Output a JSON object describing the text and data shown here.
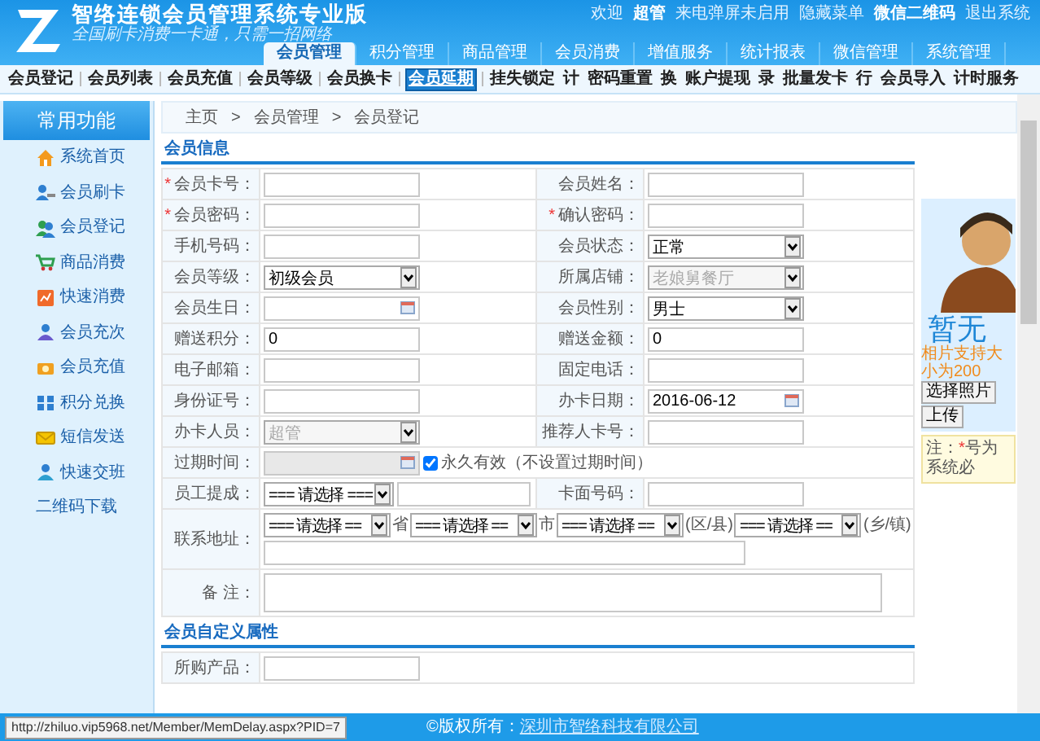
{
  "header": {
    "title": "智络连锁会员管理系统专业版",
    "slogan": "全国刷卡消费一卡通，只需一招网络",
    "user_links": [
      {
        "text": "欢迎",
        "bold": false
      },
      {
        "text": "超管",
        "bold": true
      },
      {
        "text": "来电弹屏未启用",
        "bold": false
      },
      {
        "text": "隐藏菜单",
        "bold": false
      },
      {
        "text": "微信二维码",
        "bold": true
      },
      {
        "text": "退出系统",
        "bold": false
      }
    ]
  },
  "main_tabs": [
    {
      "label": "会员管理",
      "selected": true
    },
    {
      "label": "积分管理",
      "selected": false
    },
    {
      "label": "商品管理",
      "selected": false
    },
    {
      "label": "会员消费",
      "selected": false
    },
    {
      "label": "增值服务",
      "selected": false
    },
    {
      "label": "统计报表",
      "selected": false
    },
    {
      "label": "微信管理",
      "selected": false
    },
    {
      "label": "系统管理",
      "selected": false
    }
  ],
  "sub_tabs": [
    {
      "label": "会员登记",
      "selected": false
    },
    {
      "label": "会员列表",
      "selected": false
    },
    {
      "label": "会员充值",
      "selected": false
    },
    {
      "label": "会员等级",
      "selected": false
    },
    {
      "label": "会员换卡",
      "selected": false
    },
    {
      "label": "会员延期",
      "selected": true
    },
    {
      "label": "挂失锁定",
      "selected": false
    },
    {
      "label": "计",
      "selected": false
    },
    {
      "label": "密码重置",
      "selected": false
    },
    {
      "label": "换",
      "selected": false
    },
    {
      "label": "账户提现",
      "selected": false
    },
    {
      "label": "录",
      "selected": false
    },
    {
      "label": "批量发卡",
      "selected": false
    },
    {
      "label": "行",
      "selected": false
    },
    {
      "label": "会员导入",
      "selected": false
    },
    {
      "label": "计时服务",
      "selected": false
    }
  ],
  "sidebar": {
    "title": "常用功能",
    "items": [
      {
        "label": "系统首页"
      },
      {
        "label": "会员刷卡"
      },
      {
        "label": "会员登记"
      },
      {
        "label": "商品消费"
      },
      {
        "label": "快速消费"
      },
      {
        "label": "会员充次"
      },
      {
        "label": "会员充值"
      },
      {
        "label": "积分兑换"
      },
      {
        "label": "短信发送"
      },
      {
        "label": "快速交班"
      },
      {
        "label": "二维码下载"
      }
    ]
  },
  "breadcrumb": [
    "主页",
    "会员管理",
    "会员登记"
  ],
  "breadcrumb_separator": ">",
  "member_info": {
    "title": "会员信息",
    "rows": [
      {
        "cells": [
          {
            "label": "会员卡号：",
            "mark": "*",
            "field": {
              "kind": "text"
            }
          },
          {
            "label": "会员姓名：",
            "field": {
              "kind": "text"
            }
          }
        ]
      },
      {
        "cells": [
          {
            "label": "会员密码：",
            "mark": "*",
            "field": {
              "kind": "text"
            }
          },
          {
            "label": "确认密码：",
            "mark": "*",
            "field": {
              "kind": "text"
            }
          }
        ]
      },
      {
        "cells": [
          {
            "label": "手机号码：",
            "field": {
              "kind": "text"
            }
          },
          {
            "label": "会员状态：",
            "field": {
              "kind": "select",
              "value": "正常",
              "disabled": false
            }
          }
        ]
      },
      {
        "cells": [
          {
            "label": "会员等级：",
            "field": {
              "kind": "select",
              "value": "初级会员",
              "disabled": false
            }
          },
          {
            "label": "所属店铺：",
            "field": {
              "kind": "select",
              "value": "老娘舅餐厅",
              "disabled": true
            }
          }
        ]
      },
      {
        "cells": [
          {
            "label": "会员生日：",
            "field": {
              "kind": "date",
              "disabled": false
            }
          },
          {
            "label": "会员性别：",
            "field": {
              "kind": "select",
              "value": "男士",
              "disabled": false
            }
          }
        ]
      },
      {
        "cells": [
          {
            "label": "赠送积分：",
            "field": {
              "kind": "text",
              "value": "0"
            }
          },
          {
            "label": "赠送金额：",
            "field": {
              "kind": "text",
              "value": "0"
            }
          }
        ]
      },
      {
        "cells": [
          {
            "label": "电子邮箱：",
            "field": {
              "kind": "text"
            }
          },
          {
            "label": "固定电话：",
            "field": {
              "kind": "text"
            }
          }
        ]
      },
      {
        "cells": [
          {
            "label": "身份证号：",
            "field": {
              "kind": "text"
            }
          },
          {
            "label": "办卡日期：",
            "field": {
              "kind": "date",
              "value": "2016-06-12",
              "disabled": false
            }
          }
        ]
      },
      {
        "cells": [
          {
            "label": "办卡人员：",
            "field": {
              "kind": "select",
              "value": "超管",
              "disabled": true
            }
          },
          {
            "label": "推荐人卡号：",
            "field": {
              "kind": "text"
            }
          }
        ]
      },
      {
        "cells": [
          {
            "label": "过期时间：",
            "field": {
              "kind": "check_date",
              "disabled": true,
              "checkbox": {
                "label": "永久有效（不设置过期时间）",
                "checked": true
              }
            }
          }
        ]
      },
      {
        "cells": [
          {
            "label": "员工提成：",
            "field": {
              "kind": "select_text",
              "value": "=== 请选择 ==="
            }
          },
          {
            "label": "卡面号码：",
            "field": {
              "kind": "text"
            }
          }
        ]
      },
      {
        "cells": [
          {
            "label": "联系地址：",
            "field": {
              "kind": "address",
              "selects": [
                {
                  "value": "=== 请选择 ==",
                  "suffix": "省"
                },
                {
                  "value": "=== 请选择 ==",
                  "suffix": "市"
                },
                {
                  "value": "=== 请选择 ==",
                  "suffix": "(区/县)"
                },
                {
                  "value": "=== 请选择 ==",
                  "suffix": "(乡/镇)"
                }
              ]
            }
          }
        ]
      },
      {
        "cells": [
          {
            "label": "备  注：",
            "field": {
              "kind": "textarea"
            }
          }
        ]
      }
    ]
  },
  "custom_attributes": {
    "title": "会员自定义属性",
    "rows": [
      {
        "cells": [
          {
            "label": "所购产品：",
            "field": {
              "kind": "text"
            }
          }
        ]
      }
    ]
  },
  "photo_panel": {
    "no_photo_text": "暂无",
    "hint": "相片支持大小为200",
    "buttons": [
      "选择照片",
      "上传"
    ],
    "note": {
      "prefix": "注：",
      "mark": "*",
      "text": "号为系统必"
    }
  },
  "status_url": "http://zhiluo.vip5968.net/Member/MemDelay.aspx?PID=7",
  "footer": {
    "text": "©版权所有：",
    "link": "深圳市智络科技有限公司"
  }
}
